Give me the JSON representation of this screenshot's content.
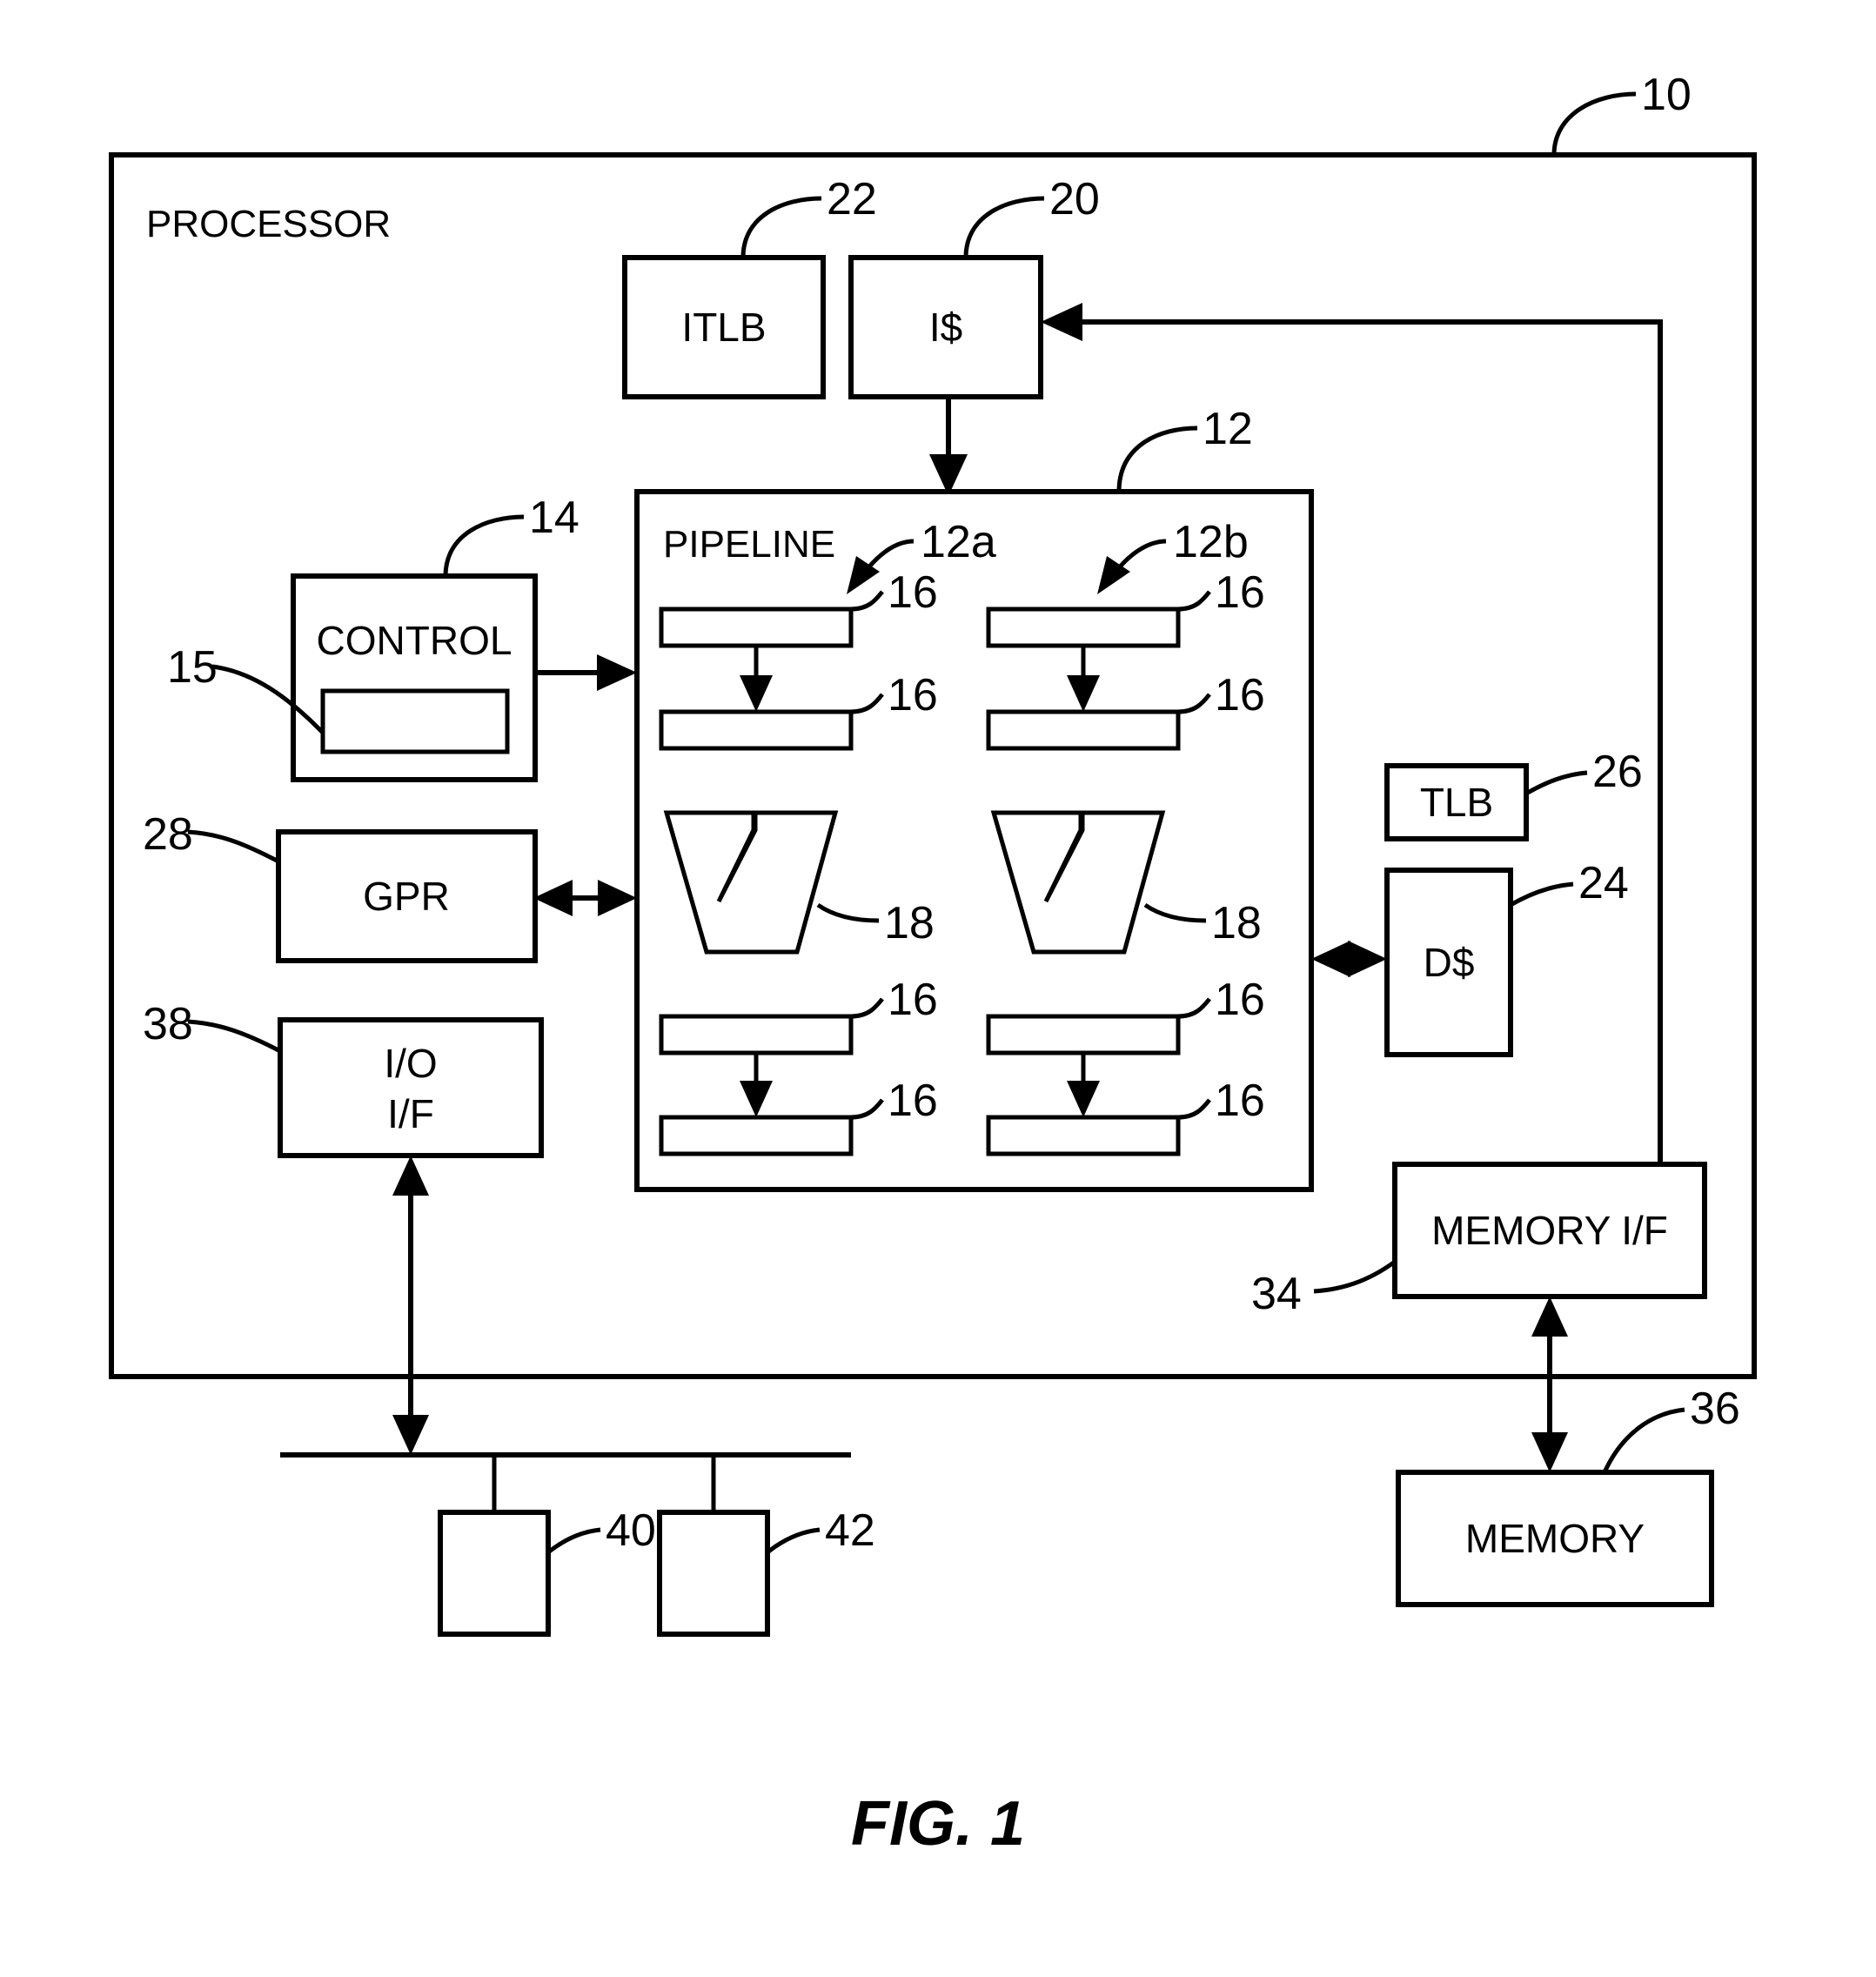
{
  "figure": {
    "caption": "FIG. 1",
    "system_label": "PROCESSOR"
  },
  "blocks": {
    "itlb": {
      "label": "ITLB",
      "ref": "22"
    },
    "icache": {
      "label": "I$",
      "ref": "20"
    },
    "pipeline": {
      "label": "PIPELINE",
      "ref": "12"
    },
    "pipe_a": {
      "ref": "12a"
    },
    "pipe_b": {
      "ref": "12b"
    },
    "control": {
      "label": "CONTROL",
      "ref": "14"
    },
    "control_inner": {
      "ref": "15"
    },
    "gpr": {
      "label": "GPR",
      "ref": "28"
    },
    "io_if": {
      "label_line1": "I/O",
      "label_line2": "I/F",
      "ref": "38"
    },
    "tlb": {
      "label": "TLB",
      "ref": "26"
    },
    "dcache": {
      "label": "D$",
      "ref": "24"
    },
    "memory_if": {
      "label": "MEMORY I/F",
      "ref": "34"
    },
    "memory": {
      "label": "MEMORY",
      "ref": "36"
    },
    "device_a": {
      "ref": "40"
    },
    "device_b": {
      "ref": "42"
    },
    "processor": {
      "ref": "10"
    }
  },
  "stage_refs": {
    "pipe_a_stage1": "16",
    "pipe_a_stage2": "16",
    "pipe_a_stage3": "16",
    "pipe_a_stage4": "16",
    "pipe_b_stage1": "16",
    "pipe_b_stage2": "16",
    "pipe_b_stage3": "16",
    "pipe_b_stage4": "16",
    "exec_a": "18",
    "exec_b": "18"
  },
  "colors": {
    "line": "#000000",
    "fill": "#ffffff"
  }
}
